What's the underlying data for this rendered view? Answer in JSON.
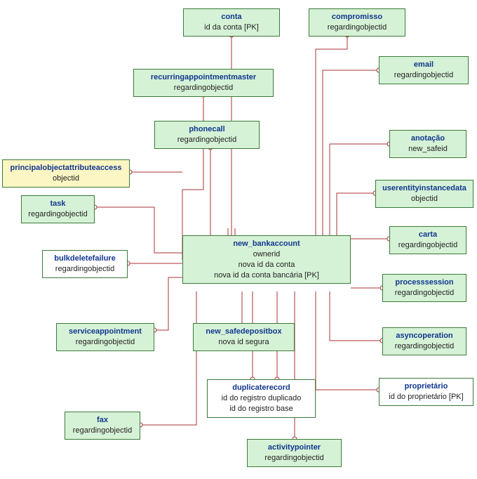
{
  "colors": {
    "green": "#d6f2d6",
    "yellow": "#fbf6c3",
    "white": "#ffffff",
    "border": "#3a7a3a",
    "title": "#11368f",
    "line": "#a33"
  },
  "entities": {
    "conta": {
      "title": "conta",
      "attrs": [
        "id da conta  [PK]"
      ]
    },
    "compromisso": {
      "title": "compromisso",
      "attrs": [
        "regardingobjectid"
      ]
    },
    "email": {
      "title": "email",
      "attrs": [
        "regardingobjectid"
      ]
    },
    "recurringappointmentmaster": {
      "title": "recurringappointmentmaster",
      "attrs": [
        "regardingobjectid"
      ]
    },
    "phonecall": {
      "title": "phonecall",
      "attrs": [
        "regardingobjectid"
      ]
    },
    "anotacao": {
      "title": "anotação",
      "attrs": [
        "new_safeid"
      ]
    },
    "principalobjectattributeaccess": {
      "title": "principalobjectattributeaccess",
      "attrs": [
        "objectid"
      ]
    },
    "userentityinstancedata": {
      "title": "userentityinstancedata",
      "attrs": [
        "objectid"
      ]
    },
    "task": {
      "title": "task",
      "attrs": [
        "regardingobjectid"
      ]
    },
    "carta": {
      "title": "carta",
      "attrs": [
        "regardingobjectid"
      ]
    },
    "bulkdeletefailure": {
      "title": "bulkdeletefailure",
      "attrs": [
        "regardingobjectid"
      ]
    },
    "new_bankaccount": {
      "title": "new_bankaccount",
      "attrs": [
        "ownerid",
        "nova id da conta",
        "nova id da conta bancária  [PK]"
      ]
    },
    "processsession": {
      "title": "processsession",
      "attrs": [
        "regardingobjectid"
      ]
    },
    "serviceappointment": {
      "title": "serviceappointment",
      "attrs": [
        "regardingobjectid"
      ]
    },
    "new_safedepositbox": {
      "title": "new_safedepositbox",
      "attrs": [
        "nova id segura"
      ]
    },
    "asyncoperation": {
      "title": "asyncoperation",
      "attrs": [
        "regardingobjectid"
      ]
    },
    "duplicaterecord": {
      "title": "duplicaterecord",
      "attrs": [
        "id do registro duplicado",
        "id do registro base"
      ]
    },
    "proprietario": {
      "title": "proprietário",
      "attrs": [
        "id do proprietário  [PK]"
      ]
    },
    "fax": {
      "title": "fax",
      "attrs": [
        "regardingobjectid"
      ]
    },
    "activitypointer": {
      "title": "activitypointer",
      "attrs": [
        "regardingobjectid"
      ]
    }
  }
}
